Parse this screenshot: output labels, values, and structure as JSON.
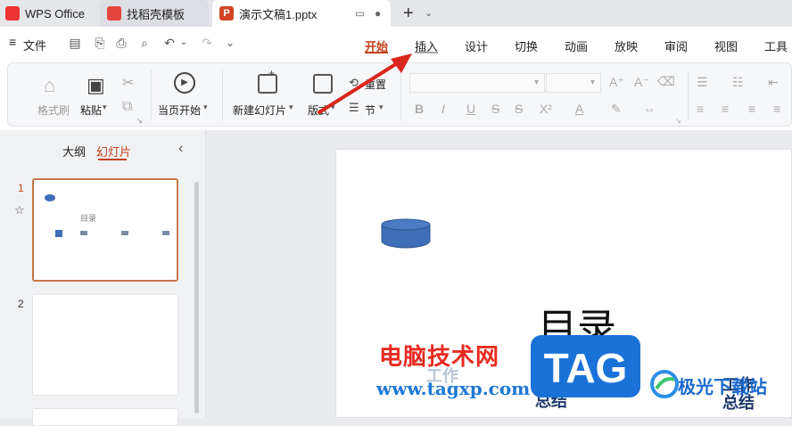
{
  "tabs": {
    "wps": "WPS Office",
    "store": "找稻壳模板",
    "doc": "演示文稿1.pptx",
    "doc_badge": "P",
    "new_tab": "+"
  },
  "menu": {
    "file": "文件",
    "ribbon_tabs": [
      "开始",
      "插入",
      "设计",
      "切换",
      "动画",
      "放映",
      "审阅",
      "视图",
      "工具"
    ]
  },
  "ribbon": {
    "format_brush": "格式刷",
    "paste": "粘贴",
    "from_current": "当页开始",
    "new_slide": "新建幻灯片",
    "layout": "版式",
    "reset": "重置",
    "section": "节",
    "icons": [
      "bold-icon",
      "italic-icon",
      "underline-icon",
      "strikethrough-icon"
    ],
    "text_b": "B",
    "text_i": "I",
    "text_u": "U",
    "text_s": "S",
    "text_x2": "X²",
    "text_a": "A"
  },
  "panel": {
    "outline": "大纲",
    "slides": "幻灯片",
    "slide_numbers": [
      "1",
      "2"
    ],
    "thumb_title": "目录"
  },
  "slide": {
    "title": "目录",
    "ghost1": "工作",
    "ghost2": "总结"
  },
  "watermark": {
    "site_name": "电脑技术网",
    "url": "www.tagxp.com",
    "tag": "TAG",
    "right_text": "极光下载站"
  },
  "colors": {
    "accent": "#c4401b",
    "arrow": "#d9261c",
    "cylinder": "#3e6fb8"
  }
}
